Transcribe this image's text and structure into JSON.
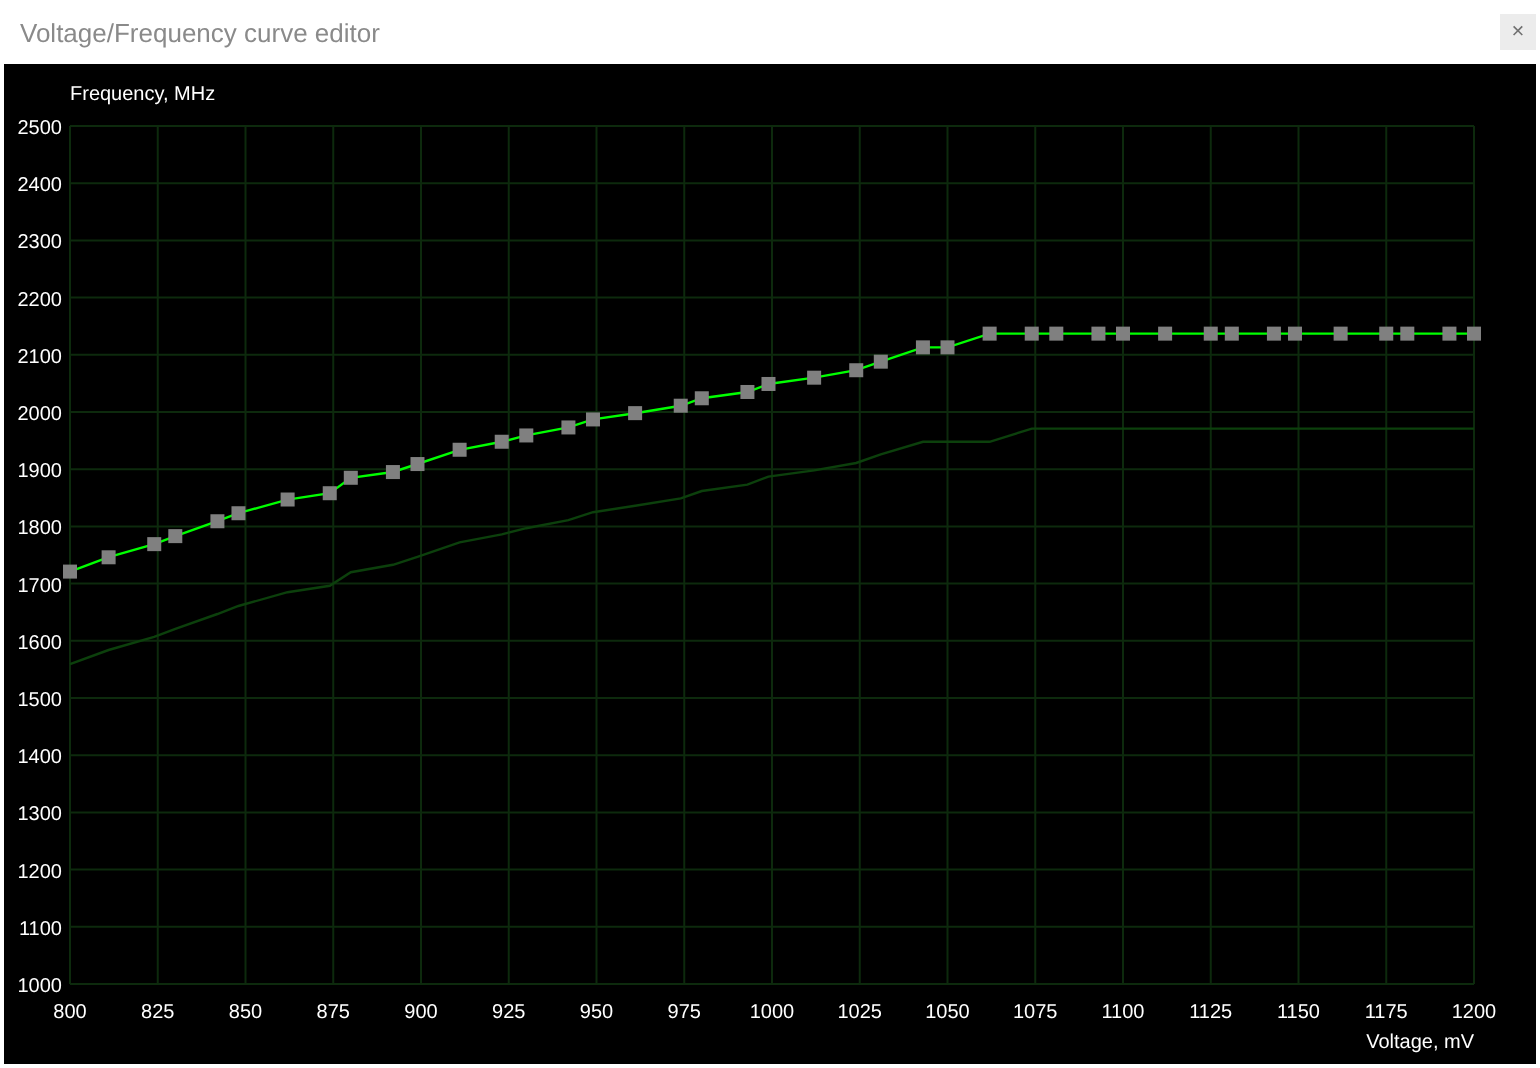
{
  "window": {
    "title": "Voltage/Frequency curve editor",
    "close_label": "×"
  },
  "chart": {
    "chart_data": {
      "type": "line",
      "grid": true,
      "xlabel": "Voltage, mV",
      "ylabel": "Frequency, MHz",
      "xlim": [
        800,
        1200
      ],
      "ylim": [
        1000,
        2500
      ],
      "xticks": [
        800,
        825,
        850,
        875,
        900,
        925,
        950,
        975,
        1000,
        1025,
        1050,
        1075,
        1100,
        1125,
        1150,
        1175,
        1200
      ],
      "yticks": [
        1000,
        1100,
        1200,
        1300,
        1400,
        1500,
        1600,
        1700,
        1800,
        1900,
        2000,
        2100,
        2200,
        2300,
        2400,
        2500
      ],
      "x": [
        800,
        811,
        824,
        830,
        842,
        848,
        862,
        874,
        880,
        892,
        899,
        911,
        923,
        930,
        942,
        949,
        961,
        974,
        980,
        993,
        999,
        1012,
        1024,
        1031,
        1043,
        1050,
        1062,
        1074,
        1081,
        1093,
        1100,
        1112,
        1125,
        1131,
        1143,
        1149,
        1162,
        1175,
        1181,
        1193,
        1200
      ],
      "series": [
        {
          "color": "#00ff00",
          "marker": "square",
          "values": [
            1721,
            1746,
            1769,
            1783,
            1809,
            1823,
            1847,
            1858,
            1885,
            1895,
            1909,
            1934,
            1948,
            1959,
            1973,
            1987,
            1998,
            2011,
            2024,
            2035,
            2049,
            2060,
            2073,
            2088,
            2113,
            2113,
            2137,
            2137,
            2137,
            2137,
            2137,
            2137,
            2137,
            2137,
            2137,
            2137,
            2137,
            2137,
            2137,
            2137,
            2137
          ]
        },
        {
          "color": "#0c400c",
          "values": [
            1559,
            1584,
            1607,
            1621,
            1647,
            1661,
            1685,
            1696,
            1720,
            1733,
            1747,
            1772,
            1786,
            1797,
            1811,
            1825,
            1836,
            1849,
            1862,
            1873,
            1887,
            1898,
            1911,
            1926,
            1948,
            1948,
            1948,
            1971,
            1971,
            1971,
            1971,
            1971,
            1971,
            1971,
            1971,
            1971,
            1971,
            1971,
            1971,
            1971,
            1971
          ]
        }
      ]
    }
  }
}
